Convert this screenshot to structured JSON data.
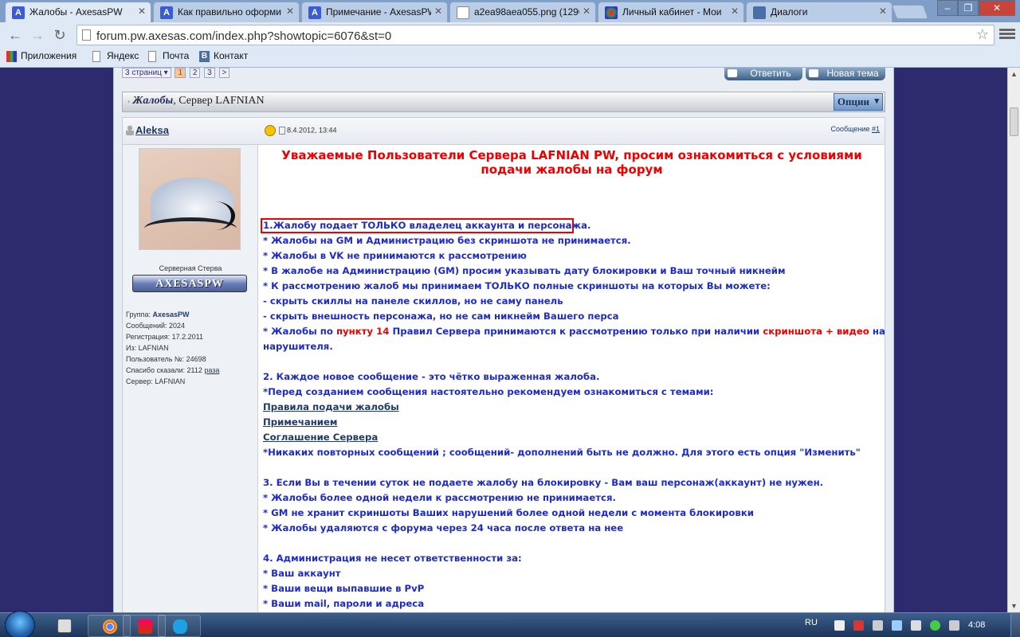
{
  "browser": {
    "tabs": [
      {
        "title": "Жалобы - AxesasPW",
        "icon": "A",
        "color": "#3b5bd6",
        "active": true
      },
      {
        "title": "Как правильно оформи",
        "icon": "A",
        "color": "#3b5bd6"
      },
      {
        "title": "Примечание - AxesasPW",
        "icon": "A",
        "color": "#3b5bd6"
      },
      {
        "title": "a2ea98aea055.png (1296",
        "icon": "",
        "color": "#ffffff"
      },
      {
        "title": "Личный кабинет - Мои",
        "icon": "",
        "color": "#d64"
      },
      {
        "title": "Диалоги",
        "icon": "",
        "color": "#4a6ea8"
      }
    ],
    "url": "forum.pw.axesas.com/index.php?showtopic=6076&st=0",
    "bookmarks": [
      {
        "label": "Приложения",
        "icon": "apps-grid-icon"
      },
      {
        "label": "Яндекс",
        "icon": "page-icon"
      },
      {
        "label": "Почта",
        "icon": "page-icon"
      },
      {
        "label": "Контакт",
        "icon": "vk-icon",
        "glyph": "B"
      }
    ]
  },
  "forum": {
    "pages_label": "3 страниц",
    "pages": [
      "1",
      "2",
      "3",
      ">"
    ],
    "reply_button": "Ответить",
    "new_topic_button": "Новая тема",
    "thread_title": "Жалобы",
    "thread_suffix": ", Сервер LAFNIAN",
    "options_button": "Опции"
  },
  "post": {
    "author": "Aleksa",
    "date": "8.4.2012, 13:44",
    "post_label": "Сообщение ",
    "post_number": "#1",
    "rank_title": "Серверная Стерва",
    "rank_badge": "AXESASPW",
    "userinfo": [
      {
        "label": "Группа: ",
        "value": "AxesasPW"
      },
      {
        "label": "Сообщений: ",
        "value": "2024"
      },
      {
        "label": "Регистрация: ",
        "value": "17.2.2011"
      },
      {
        "label": "Из: ",
        "value": "LAFNIAN"
      },
      {
        "label": "Пользователь №: ",
        "value": "24698"
      },
      {
        "label": "Спасибо сказали: ",
        "value": "2112 ",
        "link": "раза"
      },
      {
        "label": "Сервер: ",
        "value": "LAFNIAN"
      }
    ],
    "heading": "Уважаемые Пользователи Сервера LAFNIAN PW, просим ознакомиться с условиями подачи жалобы на форум",
    "lines": [
      "1.Жалобу подает ТОЛЬКО владелец аккаунта и персонажа.",
      "* Жалобы на GM и Администрацию без скриншота не принимается.",
      "* Жалобы в VK не принимаются к рассмотрению",
      "* В жалобе на Администрацию (GM) просим указывать дату блокировки и Ваш точный никнейм",
      "* К рассмотрению жалоб мы принимаем ТОЛЬКО полные скриншоты на которых Вы можете:",
      "- скрыть скиллы на панеле скиллов, но не саму панель",
      "- скрыть внешность персонажа, но не сам никнейм Вашего перса"
    ],
    "rule14": {
      "a": "* Жалобы по ",
      "b": "пункту 14",
      "c": " Правил Сервера принимаются к рассмотрению только при наличии ",
      "d": "скриншота + видео",
      "e": " на",
      "f": "нарушителя."
    },
    "section2": [
      "2. Каждое новое сообщение - это чётко выраженная жалоба.",
      "*Перед созданием сообщения настоятельно рекомендуем ознакомиться с темами:"
    ],
    "links": [
      "Правила подачи жалобы",
      "Примечанием",
      "Соглашение Сервера"
    ],
    "section2b": "*Никаких повторных сообщений ; сообщений- дополнений быть не должно. Для этого есть опция \"Изменить\"",
    "section3": [
      "3. Если Вы в течении суток не подаете жалобу на блокировку - Вам ваш персонаж(аккаунт) не нужен.",
      "* Жалобы более одной недели к рассмотрению не принимается.",
      "* GM не хранит скриншоты Ваших нарушений более одной недели с момента блокировки",
      "* Жалобы удаляются с форума через 24 часа после ответа на нее"
    ],
    "section4": [
      "4. Администрация не несет ответственности за:",
      "* Ваш аккаунт",
      "* Ваши вещи выпавшие в PvP",
      "* Ваши mail, пароли и адреса"
    ]
  },
  "taskbar": {
    "language": "RU",
    "time": "4:08"
  }
}
